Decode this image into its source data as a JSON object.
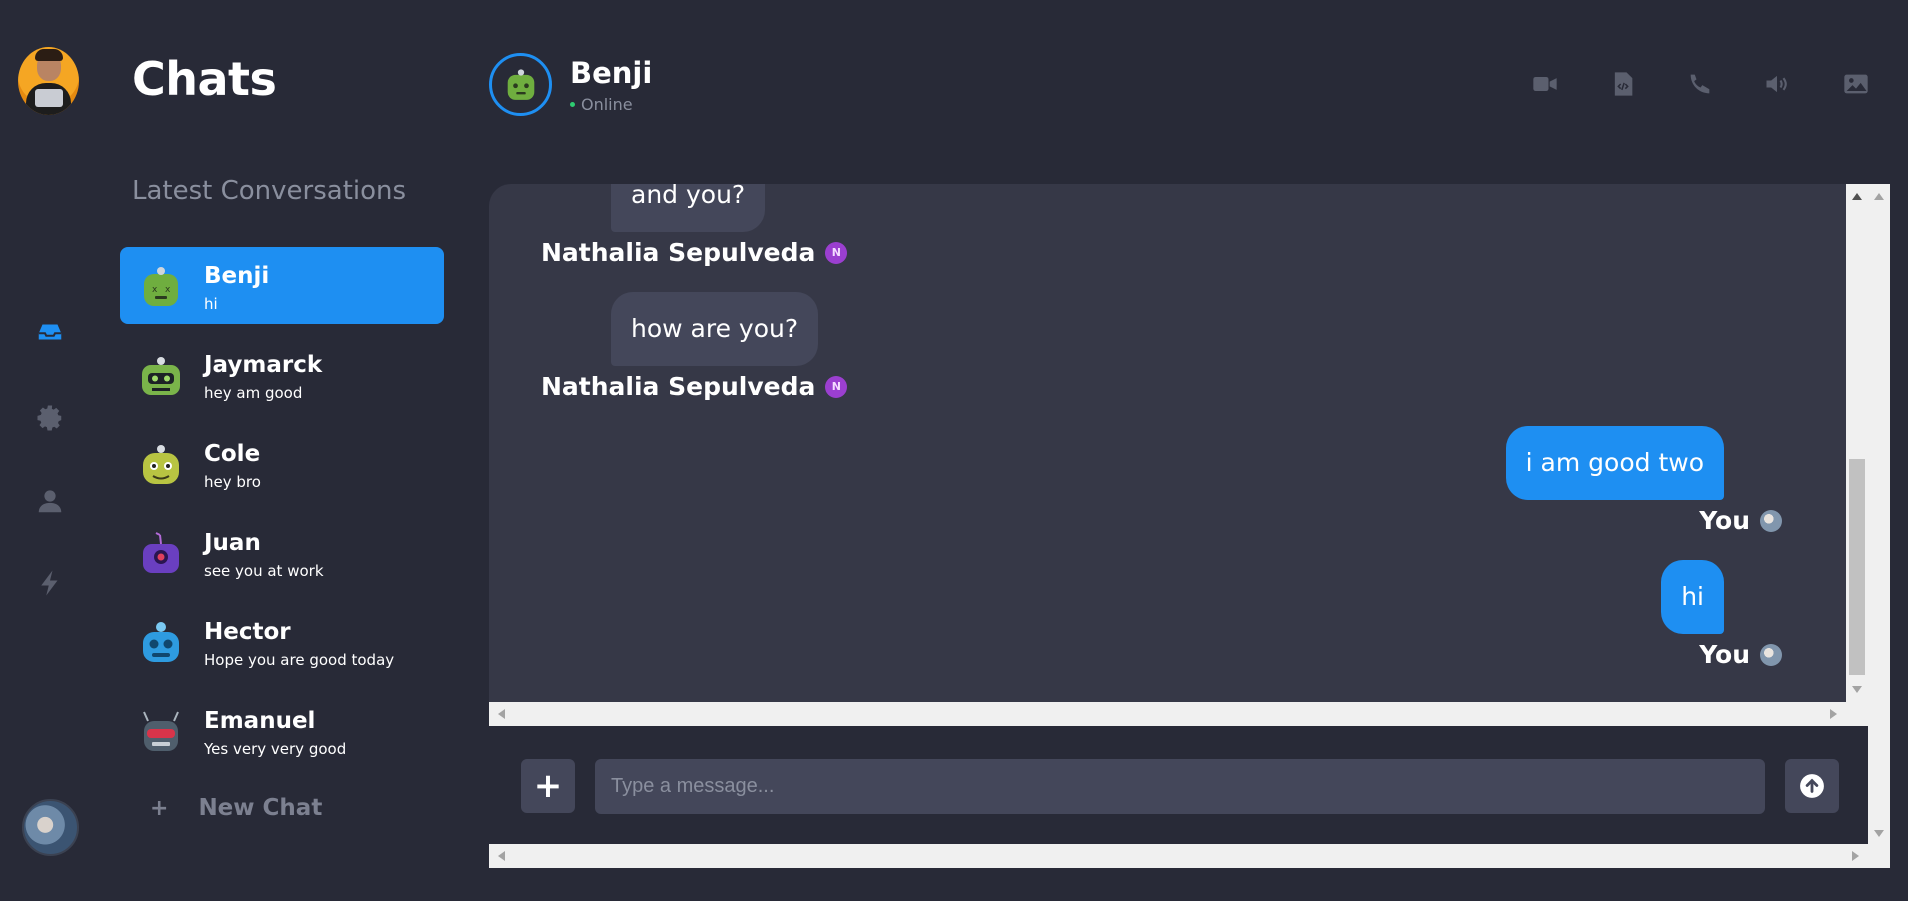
{
  "app": {
    "title": "Chats",
    "subtitle": "Latest Conversations",
    "new_chat_label": "New Chat",
    "accent": "#1e8ff2"
  },
  "rail": {
    "items": [
      {
        "icon": "inbox-icon",
        "active": true
      },
      {
        "icon": "gear-icon",
        "active": false
      },
      {
        "icon": "user-icon",
        "active": false
      },
      {
        "icon": "bolt-icon",
        "active": false
      }
    ]
  },
  "conversations": [
    {
      "name": "Benji",
      "last_message": "hi",
      "active": true
    },
    {
      "name": "Jaymarck",
      "last_message": "hey am good",
      "active": false
    },
    {
      "name": "Cole",
      "last_message": "hey bro",
      "active": false
    },
    {
      "name": "Juan",
      "last_message": "see you at work",
      "active": false
    },
    {
      "name": "Hector",
      "last_message": "Hope you are good today",
      "active": false
    },
    {
      "name": "Emanuel",
      "last_message": "Yes very very good",
      "active": false
    }
  ],
  "header": {
    "contact_name": "Benji",
    "status": "Online",
    "actions": [
      "video-icon",
      "code-file-icon",
      "phone-icon",
      "volume-icon",
      "image-icon"
    ]
  },
  "messages": [
    {
      "text": "and you?",
      "sender": "Nathalia Sepulveda",
      "badge": "N",
      "from_me": false
    },
    {
      "text": "how are you?",
      "sender": "Nathalia Sepulveda",
      "badge": "N",
      "from_me": false
    },
    {
      "text": "i am good two",
      "sender": "You",
      "from_me": true
    },
    {
      "text": "hi",
      "sender": "You",
      "from_me": true
    }
  ],
  "composer": {
    "placeholder": "Type a message...",
    "add_label": "+"
  }
}
